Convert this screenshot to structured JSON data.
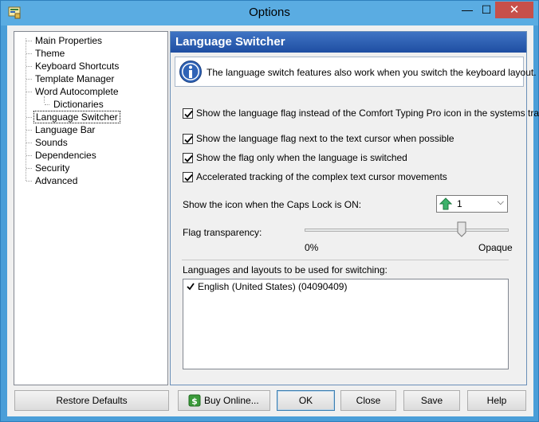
{
  "window": {
    "title": "Options",
    "app_icon": "options-app-icon",
    "minimize_icon": "minimize-icon",
    "maximize_icon": "maximize-icon",
    "close_icon": "close-icon"
  },
  "tree": {
    "items": [
      {
        "label": "Main Properties"
      },
      {
        "label": "Theme"
      },
      {
        "label": "Keyboard Shortcuts"
      },
      {
        "label": "Template Manager"
      },
      {
        "label": "Word Autocomplete"
      },
      {
        "label": "Dictionaries"
      },
      {
        "label": "Language Switcher",
        "selected": true
      },
      {
        "label": "Language Bar"
      },
      {
        "label": "Sounds"
      },
      {
        "label": "Dependencies"
      },
      {
        "label": "Security"
      },
      {
        "label": "Advanced"
      }
    ]
  },
  "panel": {
    "header": "Language Switcher",
    "info_icon": "info-icon",
    "info_text": "The language switch features also work when you switch the keyboard layout.",
    "checkboxes": [
      {
        "label": "Show the language flag instead of the Comfort Typing Pro icon in the systems tray",
        "checked": true
      },
      {
        "label": "Show the language flag next to the text cursor when possible",
        "checked": true
      },
      {
        "label": "Show the flag only when the language is switched",
        "checked": true
      },
      {
        "label": "Accelerated tracking of the complex text cursor movements",
        "checked": true
      }
    ],
    "caps_lock": {
      "label": "Show the icon when the Caps Lock is ON:",
      "selected": "1",
      "icon": "green-up-arrow-icon"
    },
    "transparency": {
      "label": "Flag transparency:",
      "min_label": "0%",
      "max_label": "Opaque",
      "value_fraction": 0.77
    },
    "languages": {
      "label": "Languages and layouts to be used for switching:",
      "items": [
        {
          "label": "English (United States) (04090409)",
          "checked": true
        }
      ]
    }
  },
  "buttons": {
    "restore": "Restore Defaults",
    "buy": "Buy Online...",
    "ok": "OK",
    "close": "Close",
    "save": "Save",
    "help": "Help"
  },
  "colors": {
    "title_bar": "#5aace2",
    "close_button": "#c7504a",
    "panel_header": "#2a5cb0"
  }
}
